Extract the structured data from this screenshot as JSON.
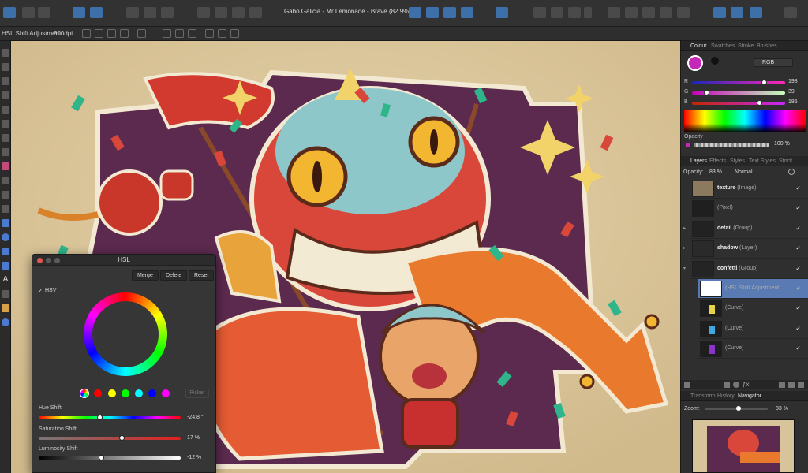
{
  "app": {
    "document_title": "Gabo Galicia - Mr Lemonade - Brave (82.9%)"
  },
  "context_bar": {
    "tool_name": "HSL Shift Adjustment",
    "dpi": "300dpi"
  },
  "right_panel": {
    "colour_tabs": [
      "Colour",
      "Swatches",
      "Stroke",
      "Brushes"
    ],
    "colour_model": "RGB",
    "channels": [
      {
        "label": "R",
        "value": "198",
        "fraction": 0.776
      },
      {
        "label": "G",
        "value": "39",
        "fraction": 0.153
      },
      {
        "label": "B",
        "value": "185",
        "fraction": 0.725
      }
    ],
    "opacity_label": "Opacity",
    "opacity_value": "100 %",
    "layer_tabs": [
      "Layers",
      "Effects",
      "Styles",
      "Text Styles",
      "Stock"
    ],
    "layer_opacity_label": "Opacity:",
    "layer_opacity_value": "83 %",
    "blend_mode": "Normal",
    "layers": [
      {
        "name": "texture",
        "type": "(Image)",
        "selected": false
      },
      {
        "name": "",
        "type": "(Pixel)",
        "selected": false
      },
      {
        "name": "detail",
        "type": "(Group)",
        "selected": false
      },
      {
        "name": "shadow",
        "type": "(Layer)",
        "selected": false
      },
      {
        "name": "confetti",
        "type": "(Group)",
        "selected": false
      },
      {
        "name": "",
        "type": "(HSL Shift Adjustment",
        "selected": true
      },
      {
        "name": "",
        "type": "(Curve)",
        "selected": false
      },
      {
        "name": "",
        "type": "(Curve)",
        "selected": false
      },
      {
        "name": "",
        "type": "(Curve)",
        "selected": false
      }
    ],
    "nav_tabs": [
      "Transform",
      "History",
      "Navigator"
    ],
    "zoom_label": "Zoom:",
    "zoom_value": "83 %"
  },
  "hsl_dialog": {
    "title": "HSL",
    "merge_label": "Merge",
    "delete_label": "Delete",
    "reset_label": "Reset",
    "hsv_label": "HSV",
    "picker_label": "Picker",
    "hue_label": "Hue Shift",
    "hue_value": "-24.8 °",
    "hue_fraction": 0.431,
    "sat_label": "Saturation Shift",
    "sat_value": "17 %",
    "sat_fraction": 0.585,
    "lum_label": "Luminosity Shift",
    "lum_value": "-12 %",
    "lum_fraction": 0.44,
    "swatch_colors": [
      "#ff0000",
      "#ffff00",
      "#00ff00",
      "#00ffff",
      "#0000ff",
      "#ff00ff"
    ]
  },
  "colors": {
    "accent": "#c627b9",
    "selection": "#5a7ab3",
    "canvas_paper": "#dcc9a0"
  }
}
